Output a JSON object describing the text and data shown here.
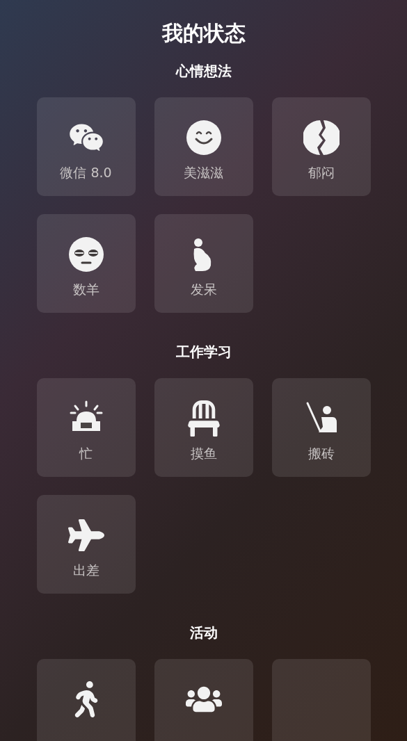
{
  "title": "我的状态",
  "sections": [
    {
      "heading": "心情想法",
      "tiles": [
        {
          "kind": "chat",
          "label": "微信 8.0"
        },
        {
          "kind": "smile",
          "label": "美滋滋"
        },
        {
          "kind": "split",
          "label": "郁闷"
        },
        {
          "kind": "sleepy",
          "label": "数羊"
        },
        {
          "kind": "thinker",
          "label": "发呆"
        }
      ]
    },
    {
      "heading": "工作学习",
      "tiles": [
        {
          "kind": "alarm",
          "label": "忙"
        },
        {
          "kind": "desk",
          "label": "摸鱼"
        },
        {
          "kind": "pick",
          "label": "搬砖"
        },
        {
          "kind": "plane",
          "label": "出差"
        }
      ]
    },
    {
      "heading": "活动",
      "tiles": [
        {
          "kind": "walk"
        },
        {
          "kind": "group"
        },
        {
          "kind": "blank"
        }
      ]
    }
  ]
}
